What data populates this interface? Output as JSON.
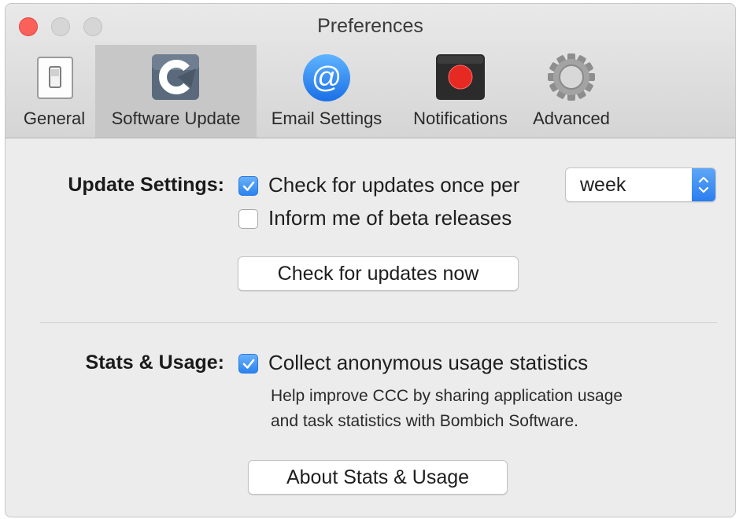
{
  "window": {
    "title": "Preferences"
  },
  "toolbar": {
    "tabs": [
      {
        "label": "General",
        "icon": "switch-icon"
      },
      {
        "label": "Software Update",
        "icon": "ccc-logo-icon",
        "active": true
      },
      {
        "label": "Email Settings",
        "icon": "at-sign-icon"
      },
      {
        "label": "Notifications",
        "icon": "record-icon"
      },
      {
        "label": "Advanced",
        "icon": "gear-icon"
      }
    ]
  },
  "update_settings": {
    "label": "Update Settings:",
    "check_updates": {
      "label": "Check for updates once per",
      "checked": true
    },
    "frequency": {
      "value": "week"
    },
    "beta": {
      "label": "Inform me of beta releases",
      "checked": false
    },
    "check_now_button": "Check for updates now"
  },
  "stats": {
    "label": "Stats & Usage:",
    "collect": {
      "label": "Collect anonymous usage statistics",
      "checked": true
    },
    "help_line1": "Help improve CCC by sharing application usage",
    "help_line2": "and task statistics with Bombich Software.",
    "about_button": "About Stats & Usage"
  },
  "colors": {
    "accent": "#2b83f0",
    "close": "#fc605b",
    "record": "#e62a23"
  }
}
